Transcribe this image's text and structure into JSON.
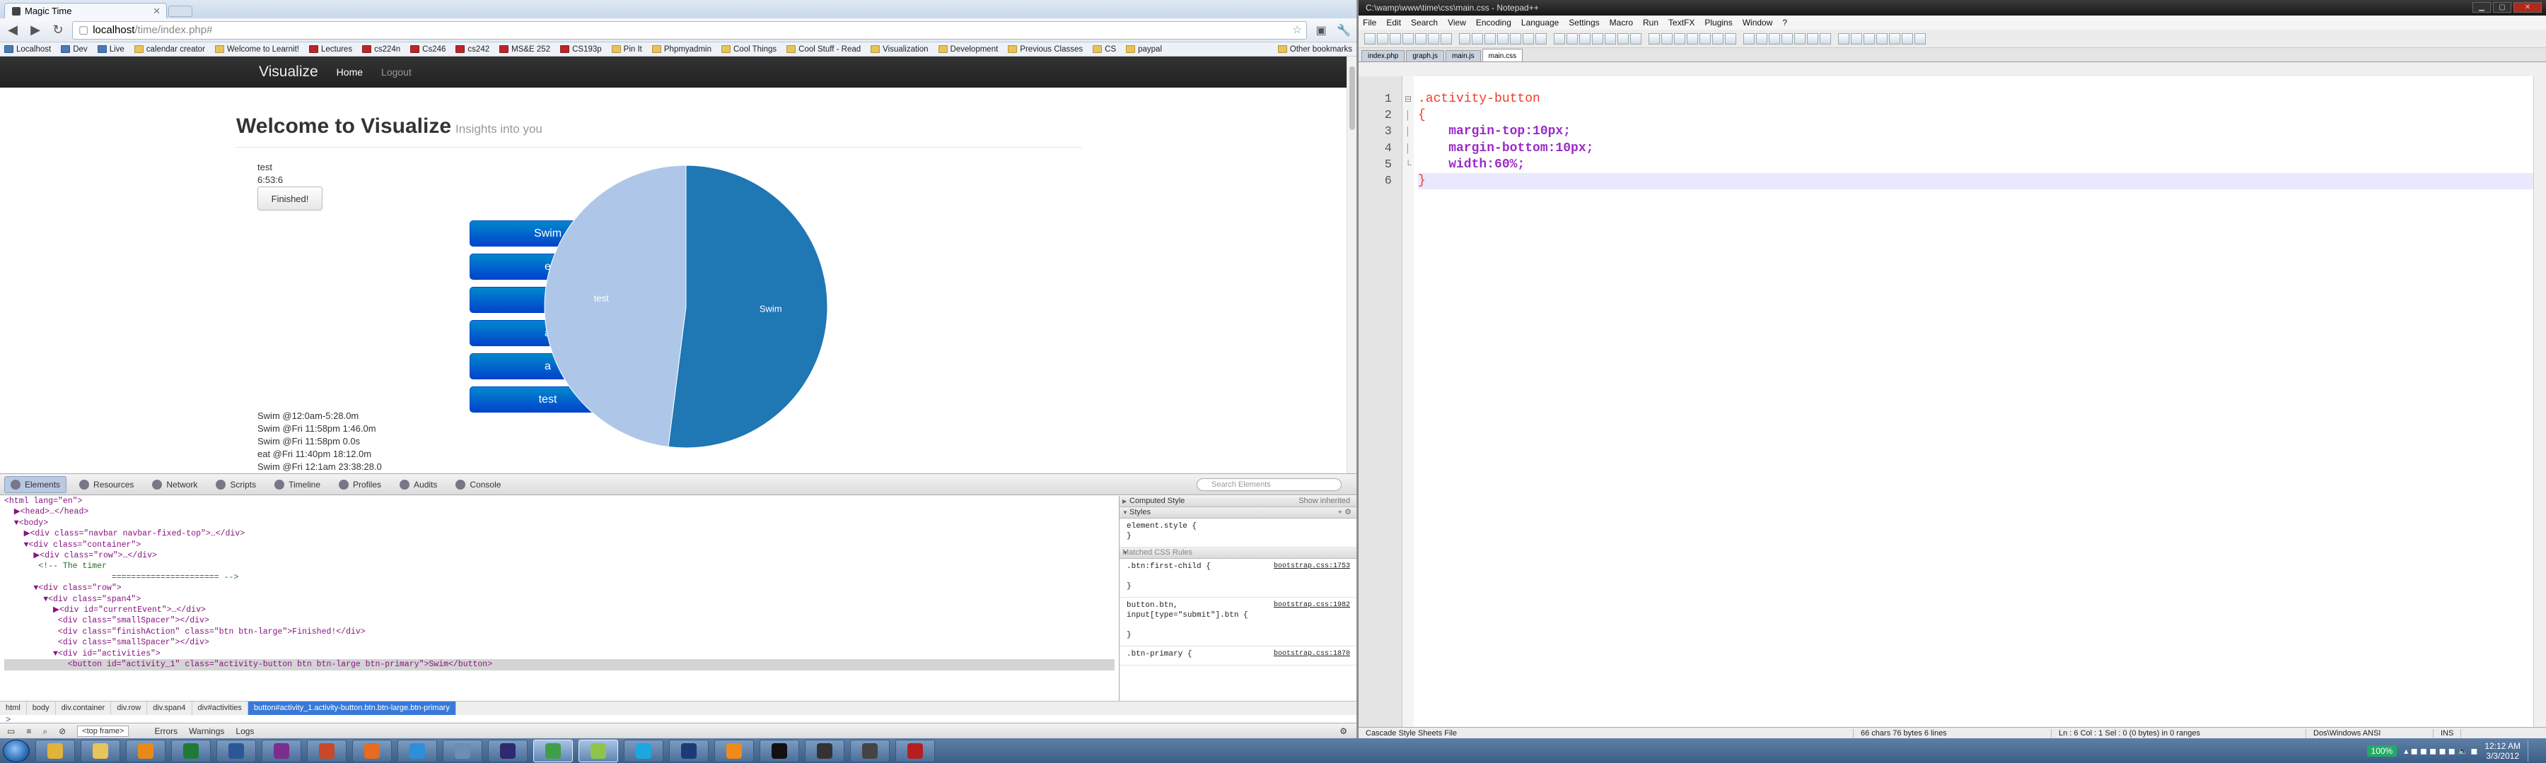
{
  "browser": {
    "tab_title": "Magic Time",
    "address_host": "localhost",
    "address_path": "/time/index.php#",
    "bookmarks": [
      "Localhost",
      "Dev",
      "Live",
      "calendar creator",
      "Welcome to Learnit!",
      "Lectures",
      "cs224n",
      "Cs246",
      "cs242",
      "MS&E 252",
      "CS193p",
      "Pin It",
      "Phpmyadmin",
      "Cool Things",
      "Cool Stuff - Read",
      "Visualization",
      "Development",
      "Previous Classes",
      "CS",
      "paypal"
    ],
    "other_bookmarks": "Other bookmarks"
  },
  "site": {
    "brand": "Visualize",
    "nav_home": "Home",
    "nav_logout": "Logout",
    "heading": "Welcome to Visualize",
    "subheading": "Insights into you",
    "current_event": "test",
    "current_time": "6:53:6",
    "finish_label": "Finished!",
    "activities": [
      "Swim",
      "e",
      "b",
      "a",
      "a",
      "test"
    ],
    "log": [
      "Swim @12:0am-5:28.0m",
      "Swim @Fri 11:58pm 1:46.0m",
      "Swim @Fri 11:58pm 0.0s",
      "eat @Fri 11:40pm 18:12.0m",
      "Swim @Fri 12:1am 23:38:28.0"
    ]
  },
  "chart_data": {
    "type": "pie",
    "labels": [
      "Swim",
      "test"
    ],
    "values": [
      52,
      48
    ],
    "colors": [
      "#1f77b4",
      "#aec7e8"
    ]
  },
  "devtools": {
    "tabs": [
      "Elements",
      "Resources",
      "Network",
      "Scripts",
      "Timeline",
      "Profiles",
      "Audits",
      "Console"
    ],
    "search_placeholder": "Search Elements",
    "dom_lines": [
      "<html lang=\"en\">",
      "  ▶<head>…</head>",
      "  ▼<body>",
      "    ▶<div class=\"navbar navbar-fixed-top\">…</div>",
      "    ▼<div class=\"container\">",
      "      ▶<div class=\"row\">…</div>",
      "       <!-- The timer",
      "                      ====================== -->",
      "      ▼<div class=\"row\">",
      "        ▼<div class=\"span4\">",
      "          ▶<div id=\"currentEvent\">…</div>",
      "           <div class=\"smallSpacer\"></div>",
      "           <div class=\"finishAction\" class=\"btn btn-large\">Finished!</div>",
      "           <div class=\"smallSpacer\"></div>",
      "          ▼<div id=\"activities\">",
      "             <button id=\"activity_1\" class=\"activity-button btn btn-large btn-primary\">Swim</button>"
    ],
    "computed_style": "Computed Style",
    "show_inherited": "Show inherited",
    "styles": "Styles",
    "element_style": "element.style {",
    "matched_rules": "Matched CSS Rules",
    "rule1": ".btn:first-child {",
    "rule1_src": "bootstrap.css:1753",
    "rule2": "button.btn,",
    "rule2b": "input[type=\"submit\"].btn {",
    "rule2_src": "bootstrap.css:1982",
    "rule3": ".btn-primary {",
    "rule3_src": "bootstrap.css:1870",
    "breadcrumbs": [
      "html",
      "body",
      "div.container",
      "div.row",
      "div.span4",
      "div#activities",
      "button#activity_1.activity-button.btn.btn-large.btn-primary"
    ],
    "prompt": ">",
    "frame": "<top frame>",
    "status_tabs": [
      "Errors",
      "Warnings",
      "Logs"
    ]
  },
  "notepad": {
    "title": "C:\\wamp\\www\\time\\css\\main.css - Notepad++",
    "menu": [
      "File",
      "Edit",
      "Search",
      "View",
      "Encoding",
      "Language",
      "Settings",
      "Macro",
      "Run",
      "TextFX",
      "Plugins",
      "Window",
      "?"
    ],
    "tabs": [
      "index.php",
      "graph.js",
      "main.js",
      "main.css"
    ],
    "code": [
      ".activity-button",
      "{",
      "    margin-top:10px;",
      "    margin-bottom:10px;",
      "    width:60%;",
      "}"
    ],
    "status_type": "Cascade Style Sheets File",
    "status_len": "66 chars   76 bytes   6 lines",
    "status_pos": "Ln : 6   Col : 1   Sel : 0 (0 bytes) in 0 ranges",
    "status_eol": "Dos\\Windows  ANSI",
    "status_ins": "INS"
  },
  "taskbar": {
    "zoom": "100%",
    "time": "12:12 AM",
    "date": "3/3/2012"
  }
}
